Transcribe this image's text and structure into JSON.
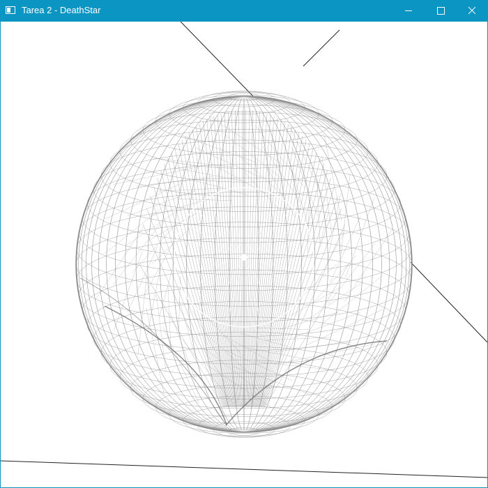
{
  "window": {
    "title": "Tarea 2 - DeathStar",
    "app_icon": "window-icon",
    "controls": {
      "minimize_icon": "minimize-icon",
      "maximize_icon": "maximize-icon",
      "close_icon": "close-icon"
    }
  },
  "colors": {
    "titlebar": "#0b95c2",
    "title_text": "#ffffff",
    "canvas": "#ffffff",
    "wireframe": "#8e8e8e",
    "wireframe_dense": "#6f6f6f",
    "axis_lines": "#222222",
    "dish_ring": "#ffffff"
  }
}
